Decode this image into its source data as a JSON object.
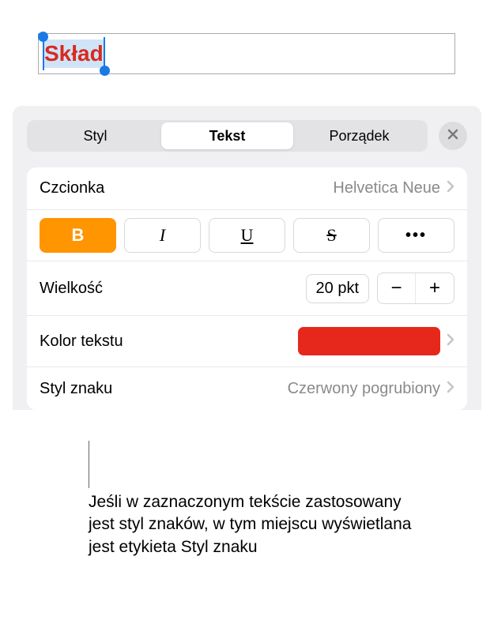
{
  "textbox": {
    "selected_text": "Skład"
  },
  "tabs": {
    "items": [
      "Styl",
      "Tekst",
      "Porządek"
    ],
    "active_index": 1
  },
  "font_row": {
    "label": "Czcionka",
    "value": "Helvetica Neue"
  },
  "style_buttons": {
    "bold": "B",
    "italic": "I",
    "underline": "U",
    "strike": "S",
    "more": "•••"
  },
  "size_row": {
    "label": "Wielkość",
    "value": "20 pkt",
    "minus": "−",
    "plus": "+"
  },
  "color_row": {
    "label": "Kolor tekstu",
    "swatch_hex": "#e5281b"
  },
  "charstyle_row": {
    "label": "Styl znaku",
    "value": "Czerwony pogrubiony"
  },
  "callout": "Jeśli w zaznaczonym tekście zastosowany jest styl znaków, w tym miejscu wyświetlana jest etykieta Styl znaku"
}
